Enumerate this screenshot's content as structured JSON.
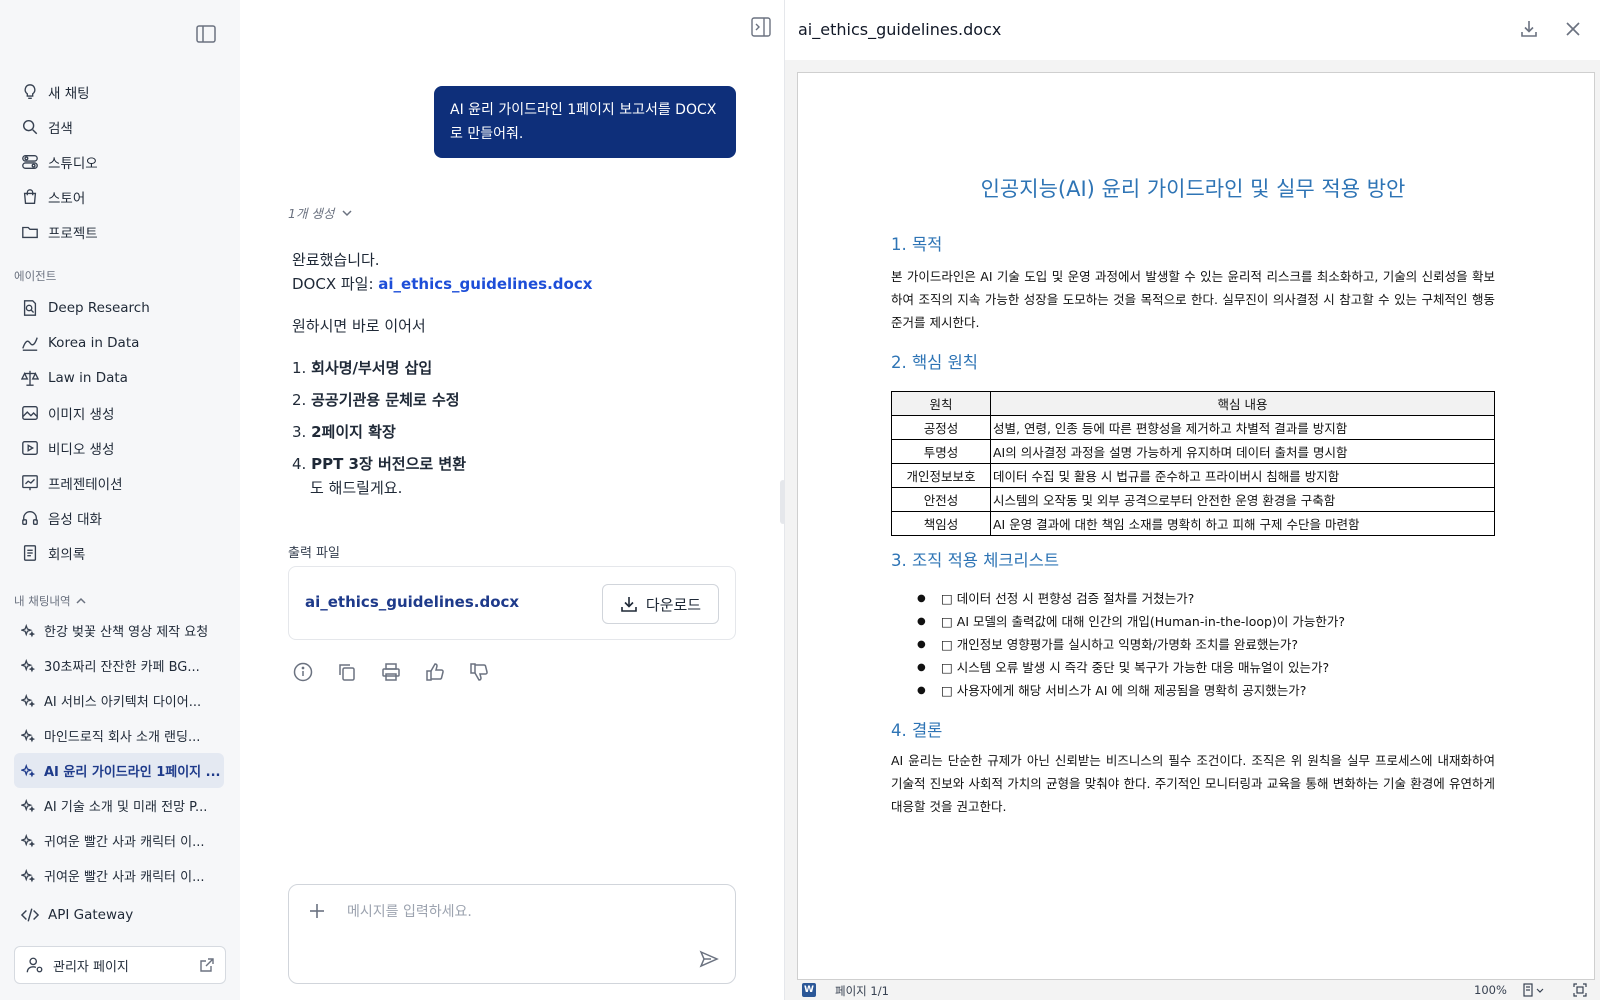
{
  "sidebar": {
    "menu": [
      {
        "label": "새 채팅",
        "icon": "bulb-icon"
      },
      {
        "label": "검색",
        "icon": "search-icon"
      },
      {
        "label": "스튜디오",
        "icon": "toggle-icon"
      },
      {
        "label": "스토어",
        "icon": "bag-icon"
      },
      {
        "label": "프로젝트",
        "icon": "folder-icon"
      }
    ],
    "agents_heading": "에이전트",
    "agents": [
      {
        "label": "Deep Research",
        "icon": "search-doc-icon"
      },
      {
        "label": "Korea in Data",
        "icon": "chart-icon"
      },
      {
        "label": "Law in Data",
        "icon": "scale-icon"
      },
      {
        "label": "이미지 생성",
        "icon": "image-icon"
      },
      {
        "label": "비디오 생성",
        "icon": "video-icon"
      },
      {
        "label": "프레젠테이션",
        "icon": "presentation-icon"
      },
      {
        "label": "음성 대화",
        "icon": "headphones-icon"
      },
      {
        "label": "회의록",
        "icon": "notes-icon"
      }
    ],
    "history_heading": "내 채팅내역",
    "history": [
      {
        "label": "한강 벚꽃 산책 영상 제작 요청",
        "active": false
      },
      {
        "label": "30초짜리 잔잔한 카페 BG...",
        "active": false
      },
      {
        "label": "AI 서비스 아키텍처 다이어...",
        "active": false
      },
      {
        "label": "마인드로직 회사 소개 랜딩...",
        "active": false
      },
      {
        "label": "AI 윤리 가이드라인 1페이지 ...",
        "active": true
      },
      {
        "label": "AI 기술 소개 및 미래 전망 P...",
        "active": false
      },
      {
        "label": "귀여운 빨간 사과 캐릭터 이...",
        "active": false
      },
      {
        "label": "귀여운 빨간 사과 캐릭터 이...",
        "active": false
      }
    ],
    "api_gateway": "API Gateway",
    "admin_page": "관리자 페이지"
  },
  "chat": {
    "user_message": "AI 윤리 가이드라인 1페이지 보고서를 DOCX로 만들어줘.",
    "generation_toggle": "1개 생성",
    "answer": {
      "line1": "완료했습니다.",
      "file_prefix": "DOCX 파일: ",
      "file_link": "ai_ethics_guidelines.docx",
      "offer": "원하시면 바로 이어서",
      "options": [
        {
          "num": "1. ",
          "text": "회사명/부서명 삽입"
        },
        {
          "num": "2. ",
          "text": "공공기관용 문체로 수정"
        },
        {
          "num": "3. ",
          "text": "2페이지 확장"
        },
        {
          "num": "4. ",
          "text": "PPT 3장 버전으로 변환"
        }
      ],
      "tail": "도 해드릴게요."
    },
    "output_label": "출력 파일",
    "output_file": "ai_ethics_guidelines.docx",
    "download_label": "다운로드",
    "composer_placeholder": "메시지를 입력하세요."
  },
  "viewer": {
    "title": "ai_ethics_guidelines.docx",
    "doc": {
      "title": "인공지능(AI) 윤리 가이드라인 및 실무 적용 방안",
      "s1_heading": "1. 목적",
      "s1_body": "본 가이드라인은 AI 기술 도입 및 운영 과정에서 발생할 수 있는 윤리적 리스크를 최소화하고, 기술의 신뢰성을 확보하여 조직의 지속 가능한 성장을 도모하는 것을 목적으로 한다. 실무진이 의사결정 시 참고할 수 있는 구체적인 행동 준거를 제시한다.",
      "s2_heading": "2. 핵심 원칙",
      "table_headers": [
        "원칙",
        "핵심 내용"
      ],
      "table_rows": [
        [
          "공정성",
          "성별, 연령, 인종 등에 따른 편향성을 제거하고 차별적 결과를 방지함"
        ],
        [
          "투명성",
          "AI의 의사결정 과정을 설명 가능하게 유지하며 데이터 출처를 명시함"
        ],
        [
          "개인정보보호",
          "데이터 수집 및 활용 시 법규를 준수하고 프라이버시 침해를 방지함"
        ],
        [
          "안전성",
          "시스템의 오작동 및 외부 공격으로부터 안전한 운영 환경을 구축함"
        ],
        [
          "책임성",
          "AI 운영 결과에 대한 책임 소재를 명확히 하고 피해 구제 수단을 마련함"
        ]
      ],
      "s3_heading": "3. 조직 적용 체크리스트",
      "checklist": [
        "□ 데이터 선정 시 편향성 검증 절차를 거쳤는가?",
        "□ AI 모델의 출력값에 대해 인간의 개입(Human-in-the-loop)이 가능한가?",
        "□ 개인정보 영향평가를 실시하고 익명화/가명화 조치를 완료했는가?",
        "□ 시스템 오류 발생 시 즉각 중단 및 복구가 가능한 대응 매뉴얼이 있는가?",
        "□ 사용자에게 해당 서비스가 AI 에 의해 제공됨을 명확히 공지했는가?"
      ],
      "s4_heading": "4. 결론",
      "s4_body": "AI 윤리는 단순한 규제가 아닌 신뢰받는 비즈니스의 필수 조건이다. 조직은 위 원칙을 실무 프로세스에 내재화하여 기술적 진보와 사회적 가치의 균형을 맞춰야 한다. 주기적인 모니터링과 교육을 통해 변화하는 기술 환경에 유연하게 대응할 것을 권고한다."
    },
    "status": {
      "word_badge": "W",
      "page": "페이지 1/1",
      "zoom": "100%"
    }
  },
  "colors": {
    "accent": "#0e2f7a",
    "link": "#1d4ed8",
    "doc_heading": "#2e74b5",
    "sidebar_bg": "#f6f7f9",
    "active_bg": "#e4e9f2"
  }
}
